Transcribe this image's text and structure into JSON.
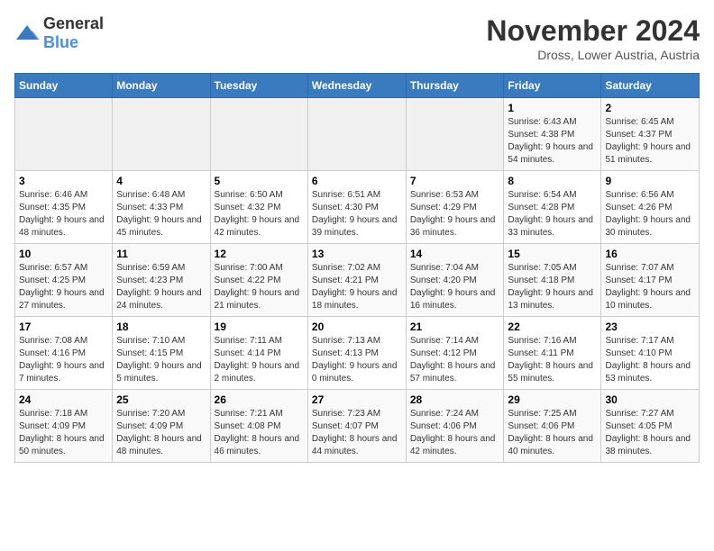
{
  "logo": {
    "general": "General",
    "blue": "Blue"
  },
  "header": {
    "month": "November 2024",
    "location": "Dross, Lower Austria, Austria"
  },
  "weekdays": [
    "Sunday",
    "Monday",
    "Tuesday",
    "Wednesday",
    "Thursday",
    "Friday",
    "Saturday"
  ],
  "weeks": [
    [
      {
        "day": "",
        "sunrise": "",
        "sunset": "",
        "daylight": ""
      },
      {
        "day": "",
        "sunrise": "",
        "sunset": "",
        "daylight": ""
      },
      {
        "day": "",
        "sunrise": "",
        "sunset": "",
        "daylight": ""
      },
      {
        "day": "",
        "sunrise": "",
        "sunset": "",
        "daylight": ""
      },
      {
        "day": "",
        "sunrise": "",
        "sunset": "",
        "daylight": ""
      },
      {
        "day": "1",
        "sunrise": "Sunrise: 6:43 AM",
        "sunset": "Sunset: 4:38 PM",
        "daylight": "Daylight: 9 hours and 54 minutes."
      },
      {
        "day": "2",
        "sunrise": "Sunrise: 6:45 AM",
        "sunset": "Sunset: 4:37 PM",
        "daylight": "Daylight: 9 hours and 51 minutes."
      }
    ],
    [
      {
        "day": "3",
        "sunrise": "Sunrise: 6:46 AM",
        "sunset": "Sunset: 4:35 PM",
        "daylight": "Daylight: 9 hours and 48 minutes."
      },
      {
        "day": "4",
        "sunrise": "Sunrise: 6:48 AM",
        "sunset": "Sunset: 4:33 PM",
        "daylight": "Daylight: 9 hours and 45 minutes."
      },
      {
        "day": "5",
        "sunrise": "Sunrise: 6:50 AM",
        "sunset": "Sunset: 4:32 PM",
        "daylight": "Daylight: 9 hours and 42 minutes."
      },
      {
        "day": "6",
        "sunrise": "Sunrise: 6:51 AM",
        "sunset": "Sunset: 4:30 PM",
        "daylight": "Daylight: 9 hours and 39 minutes."
      },
      {
        "day": "7",
        "sunrise": "Sunrise: 6:53 AM",
        "sunset": "Sunset: 4:29 PM",
        "daylight": "Daylight: 9 hours and 36 minutes."
      },
      {
        "day": "8",
        "sunrise": "Sunrise: 6:54 AM",
        "sunset": "Sunset: 4:28 PM",
        "daylight": "Daylight: 9 hours and 33 minutes."
      },
      {
        "day": "9",
        "sunrise": "Sunrise: 6:56 AM",
        "sunset": "Sunset: 4:26 PM",
        "daylight": "Daylight: 9 hours and 30 minutes."
      }
    ],
    [
      {
        "day": "10",
        "sunrise": "Sunrise: 6:57 AM",
        "sunset": "Sunset: 4:25 PM",
        "daylight": "Daylight: 9 hours and 27 minutes."
      },
      {
        "day": "11",
        "sunrise": "Sunrise: 6:59 AM",
        "sunset": "Sunset: 4:23 PM",
        "daylight": "Daylight: 9 hours and 24 minutes."
      },
      {
        "day": "12",
        "sunrise": "Sunrise: 7:00 AM",
        "sunset": "Sunset: 4:22 PM",
        "daylight": "Daylight: 9 hours and 21 minutes."
      },
      {
        "day": "13",
        "sunrise": "Sunrise: 7:02 AM",
        "sunset": "Sunset: 4:21 PM",
        "daylight": "Daylight: 9 hours and 18 minutes."
      },
      {
        "day": "14",
        "sunrise": "Sunrise: 7:04 AM",
        "sunset": "Sunset: 4:20 PM",
        "daylight": "Daylight: 9 hours and 16 minutes."
      },
      {
        "day": "15",
        "sunrise": "Sunrise: 7:05 AM",
        "sunset": "Sunset: 4:18 PM",
        "daylight": "Daylight: 9 hours and 13 minutes."
      },
      {
        "day": "16",
        "sunrise": "Sunrise: 7:07 AM",
        "sunset": "Sunset: 4:17 PM",
        "daylight": "Daylight: 9 hours and 10 minutes."
      }
    ],
    [
      {
        "day": "17",
        "sunrise": "Sunrise: 7:08 AM",
        "sunset": "Sunset: 4:16 PM",
        "daylight": "Daylight: 9 hours and 7 minutes."
      },
      {
        "day": "18",
        "sunrise": "Sunrise: 7:10 AM",
        "sunset": "Sunset: 4:15 PM",
        "daylight": "Daylight: 9 hours and 5 minutes."
      },
      {
        "day": "19",
        "sunrise": "Sunrise: 7:11 AM",
        "sunset": "Sunset: 4:14 PM",
        "daylight": "Daylight: 9 hours and 2 minutes."
      },
      {
        "day": "20",
        "sunrise": "Sunrise: 7:13 AM",
        "sunset": "Sunset: 4:13 PM",
        "daylight": "Daylight: 9 hours and 0 minutes."
      },
      {
        "day": "21",
        "sunrise": "Sunrise: 7:14 AM",
        "sunset": "Sunset: 4:12 PM",
        "daylight": "Daylight: 8 hours and 57 minutes."
      },
      {
        "day": "22",
        "sunrise": "Sunrise: 7:16 AM",
        "sunset": "Sunset: 4:11 PM",
        "daylight": "Daylight: 8 hours and 55 minutes."
      },
      {
        "day": "23",
        "sunrise": "Sunrise: 7:17 AM",
        "sunset": "Sunset: 4:10 PM",
        "daylight": "Daylight: 8 hours and 53 minutes."
      }
    ],
    [
      {
        "day": "24",
        "sunrise": "Sunrise: 7:18 AM",
        "sunset": "Sunset: 4:09 PM",
        "daylight": "Daylight: 8 hours and 50 minutes."
      },
      {
        "day": "25",
        "sunrise": "Sunrise: 7:20 AM",
        "sunset": "Sunset: 4:09 PM",
        "daylight": "Daylight: 8 hours and 48 minutes."
      },
      {
        "day": "26",
        "sunrise": "Sunrise: 7:21 AM",
        "sunset": "Sunset: 4:08 PM",
        "daylight": "Daylight: 8 hours and 46 minutes."
      },
      {
        "day": "27",
        "sunrise": "Sunrise: 7:23 AM",
        "sunset": "Sunset: 4:07 PM",
        "daylight": "Daylight: 8 hours and 44 minutes."
      },
      {
        "day": "28",
        "sunrise": "Sunrise: 7:24 AM",
        "sunset": "Sunset: 4:06 PM",
        "daylight": "Daylight: 8 hours and 42 minutes."
      },
      {
        "day": "29",
        "sunrise": "Sunrise: 7:25 AM",
        "sunset": "Sunset: 4:06 PM",
        "daylight": "Daylight: 8 hours and 40 minutes."
      },
      {
        "day": "30",
        "sunrise": "Sunrise: 7:27 AM",
        "sunset": "Sunset: 4:05 PM",
        "daylight": "Daylight: 8 hours and 38 minutes."
      }
    ]
  ]
}
